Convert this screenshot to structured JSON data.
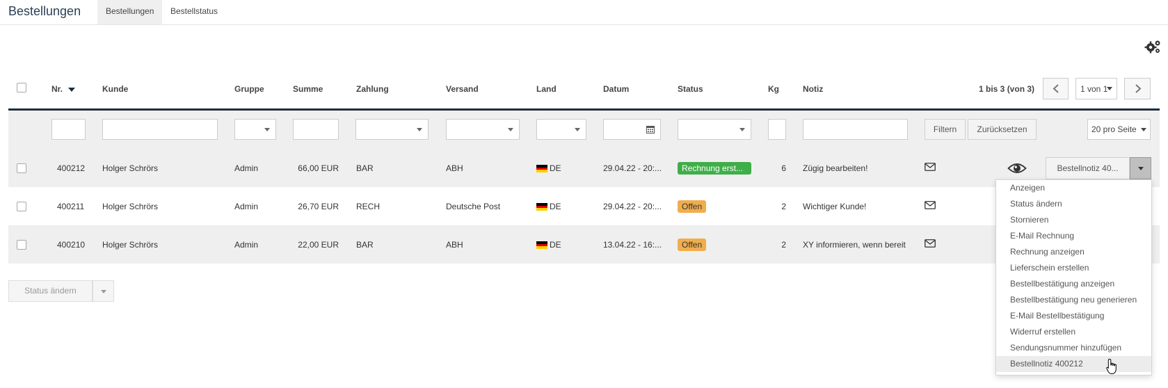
{
  "header": {
    "title": "Bestellungen",
    "tabs": [
      {
        "label": "Bestellungen",
        "active": true
      },
      {
        "label": "Bestellstatus",
        "active": false
      }
    ]
  },
  "icons": {
    "settings": "gears-icon",
    "sort": "caret-down-icon",
    "calendar": "calendar-icon",
    "mail": "envelope-icon",
    "view": "eye-icon",
    "cursor": "hand-pointer-icon"
  },
  "table": {
    "columns": [
      "Nr.",
      "Kunde",
      "Gruppe",
      "Summe",
      "Zahlung",
      "Versand",
      "Land",
      "Datum",
      "Status",
      "Kg",
      "Notiz"
    ],
    "pagination": {
      "summary": "1 bis 3 (von 3)",
      "page": "1 von 1"
    },
    "filter": {
      "filter_label": "Filtern",
      "reset_label": "Zurücksetzen",
      "per_page": "20 pro Seite"
    },
    "rows": [
      {
        "nr": "400212",
        "kunde": "Holger Schrörs",
        "gruppe": "Admin",
        "summe": "66,00 EUR",
        "zahlung": "BAR",
        "versand": "ABH",
        "land": "DE",
        "datum": "29.04.22 - 20:...",
        "status": "Rechnung erst...",
        "status_color": "#3fae49",
        "kg": "6",
        "notiz": "Zügig bearbeiten!"
      },
      {
        "nr": "400211",
        "kunde": "Holger Schrörs",
        "gruppe": "Admin",
        "summe": "26,70 EUR",
        "zahlung": "RECH",
        "versand": "Deutsche Post",
        "land": "DE",
        "datum": "29.04.22 - 20:...",
        "status": "Offen",
        "status_color": "#f0ad4e",
        "kg": "2",
        "notiz": "Wichtiger Kunde!"
      },
      {
        "nr": "400210",
        "kunde": "Holger Schrörs",
        "gruppe": "Admin",
        "summe": "22,00 EUR",
        "zahlung": "BAR",
        "versand": "ABH",
        "land": "DE",
        "datum": "13.04.22 - 16:...",
        "status": "Offen",
        "status_color": "#f0ad4e",
        "kg": "2",
        "notiz": "XY informieren, wenn bereit"
      }
    ]
  },
  "row_action": {
    "label": "Bestellnotiz 40..."
  },
  "menu": {
    "items": [
      "Anzeigen",
      "Status ändern",
      "Stornieren",
      "E-Mail Rechnung",
      "Rechnung anzeigen",
      "Lieferschein erstellen",
      "Bestellbestätigung anzeigen",
      "Bestellbestätigung neu generieren",
      "E-Mail Bestellbestätigung",
      "Widerruf erstellen",
      "Sendungsnummer hinzufügen",
      "Bestellnotiz 400212"
    ],
    "hovered_index": 11
  },
  "bulk": {
    "label": "Status ändern"
  },
  "colors": {
    "accent_dark": "#1f2d3a",
    "status_green": "#3fae49",
    "status_orange": "#f0ad4e"
  }
}
